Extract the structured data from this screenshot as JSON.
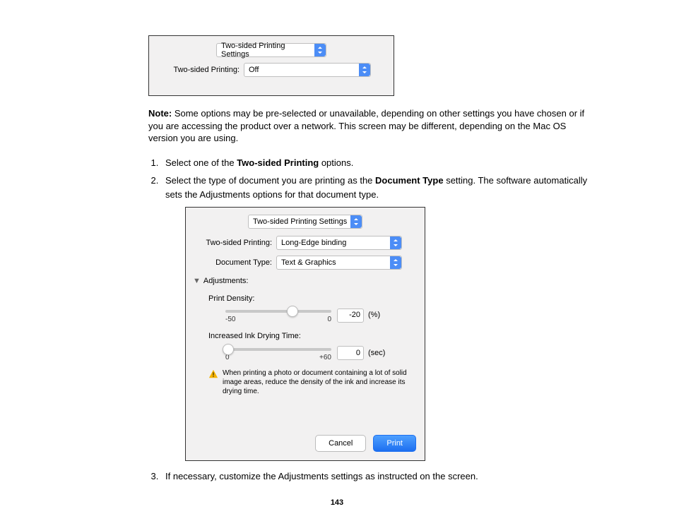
{
  "panel1": {
    "menu": "Two-sided Printing Settings",
    "row_label": "Two-sided Printing:",
    "row_value": "Off"
  },
  "note": {
    "prefix": "Note:",
    "text": " Some options may be pre-selected or unavailable, depending on other settings you have chosen or if you are accessing the product over a network. This screen may be different, depending on the Mac OS version you are using."
  },
  "steps": {
    "s1_pre": "Select one of the ",
    "s1_bold": "Two-sided Printing",
    "s1_post": " options.",
    "s2_pre": "Select the type of document you are printing as the ",
    "s2_bold": "Document Type",
    "s2_post": " setting. The software automatically sets the Adjustments options for that document type.",
    "s3": "If necessary, customize the Adjustments settings as instructed on the screen."
  },
  "panel2": {
    "menu": "Two-sided Printing Settings",
    "twoSidedLabel": "Two-sided Printing:",
    "twoSidedValue": "Long-Edge binding",
    "docTypeLabel": "Document Type:",
    "docTypeValue": "Text & Graphics",
    "adjustments": "Adjustments:",
    "printDensity": "Print Density:",
    "dens_min": "-50",
    "dens_max": "0",
    "dens_val": "-20",
    "dens_unit": "(%)",
    "dryTime": "Increased Ink Drying Time:",
    "dry_min": "0",
    "dry_max": "+60",
    "dry_val": "0",
    "dry_unit": "(sec)",
    "warn": "When printing a photo or document containing a lot of solid image areas, reduce the density of the ink and increase its drying time.",
    "cancel": "Cancel",
    "print": "Print"
  },
  "page_number": "143"
}
